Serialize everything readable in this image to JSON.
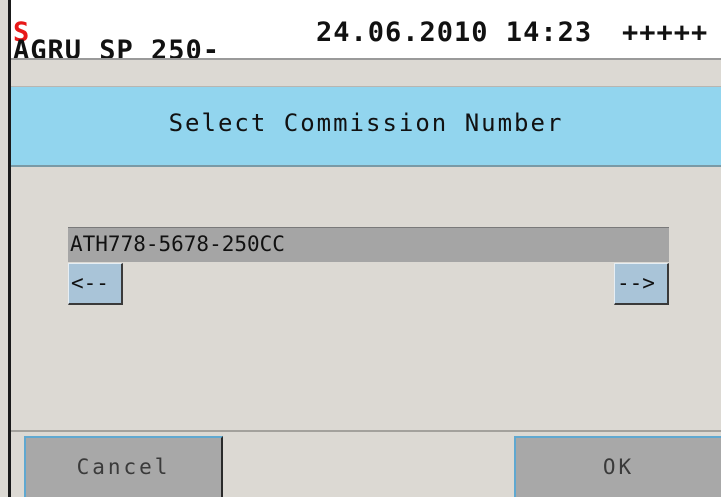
{
  "header": {
    "device_name": "AGRU SP 250-",
    "device_suffix": "S",
    "datetime": "24.06.2010 14:23",
    "status": "+++++"
  },
  "dialog": {
    "title": "Select Commission Number",
    "value": "ATH778-5678-250CC",
    "prev_label": "<--",
    "next_label": "-->"
  },
  "buttons": {
    "cancel": "Cancel",
    "ok": "OK"
  },
  "colors": {
    "title_band": "#92d5ee",
    "background": "#dcd9d3",
    "accent_red": "#e81818",
    "button_gray": "#a8a8a8",
    "arrow_button": "#a9c4d8"
  }
}
